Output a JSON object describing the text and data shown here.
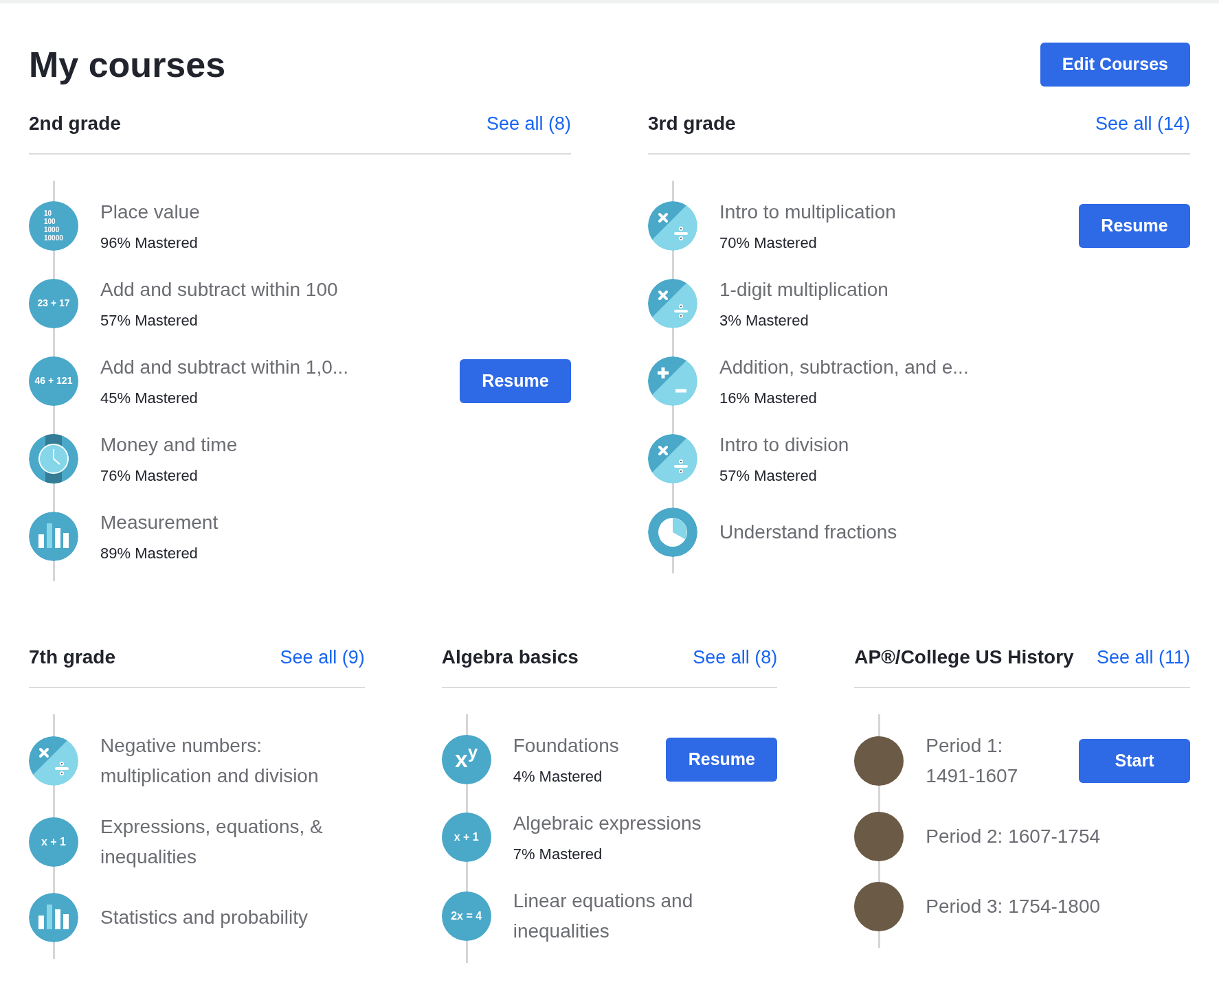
{
  "title": "My courses",
  "edit_button": "Edit Courses",
  "sections": [
    {
      "name": "2nd grade",
      "see_all": "See all (8)",
      "items": [
        {
          "kind": "text",
          "icon_lines": [
            "10",
            "100",
            "1000",
            "10000"
          ],
          "title": "Place value",
          "mastery": "96% Mastered"
        },
        {
          "kind": "text",
          "icon_lines": [
            "23 + 17"
          ],
          "title": "Add and subtract within 100",
          "mastery": "57% Mastered"
        },
        {
          "kind": "text",
          "icon_lines": [
            "46 + 121"
          ],
          "title": "Add and subtract within 1,0...",
          "mastery": "45% Mastered",
          "action": "Resume"
        },
        {
          "kind": "clock",
          "title": "Money and time",
          "mastery": "76% Mastered"
        },
        {
          "kind": "bars",
          "title": "Measurement",
          "mastery": "89% Mastered"
        }
      ]
    },
    {
      "name": "3rd grade",
      "see_all": "See all (14)",
      "items": [
        {
          "kind": "muldiv",
          "title": "Intro to multiplication",
          "mastery": "70% Mastered",
          "action": "Resume"
        },
        {
          "kind": "muldiv",
          "title": "1-digit multiplication",
          "mastery": "3% Mastered"
        },
        {
          "kind": "plusminus",
          "title": "Addition, subtraction, and e...",
          "mastery": "16% Mastered"
        },
        {
          "kind": "muldiv",
          "title": "Intro to division",
          "mastery": "57% Mastered"
        },
        {
          "kind": "pie",
          "title": "Understand fractions"
        }
      ]
    },
    {
      "name": "7th grade",
      "see_all": "See all (9)",
      "items": [
        {
          "kind": "muldiv",
          "title": "Negative numbers: multiplication and division"
        },
        {
          "kind": "text",
          "icon_lines": [
            "x + 1"
          ],
          "title": "Expressions, equations, & inequalities"
        },
        {
          "kind": "bars",
          "title": "Statistics and probability"
        }
      ]
    },
    {
      "name": "Algebra basics",
      "see_all": "See all (8)",
      "items": [
        {
          "kind": "power",
          "icon_lines": [
            "x$^{y}$"
          ],
          "title": "Foundations",
          "mastery": "4% Mastered",
          "action": "Resume"
        },
        {
          "kind": "text",
          "icon_lines": [
            "x + 1"
          ],
          "title": "Algebraic expressions",
          "mastery": "7% Mastered"
        },
        {
          "kind": "text",
          "icon_lines": [
            "2x = 4"
          ],
          "title": "Linear equations and inequalities"
        }
      ]
    },
    {
      "name": "AP®/College US History",
      "see_all": "See all (11)",
      "items": [
        {
          "kind": "photo",
          "title": "Period 1: 1491-1607",
          "action": "Start"
        },
        {
          "kind": "photo",
          "title": "Period 2: 1607-1754"
        },
        {
          "kind": "photo",
          "title": "Period 3: 1754-1800"
        }
      ]
    }
  ]
}
